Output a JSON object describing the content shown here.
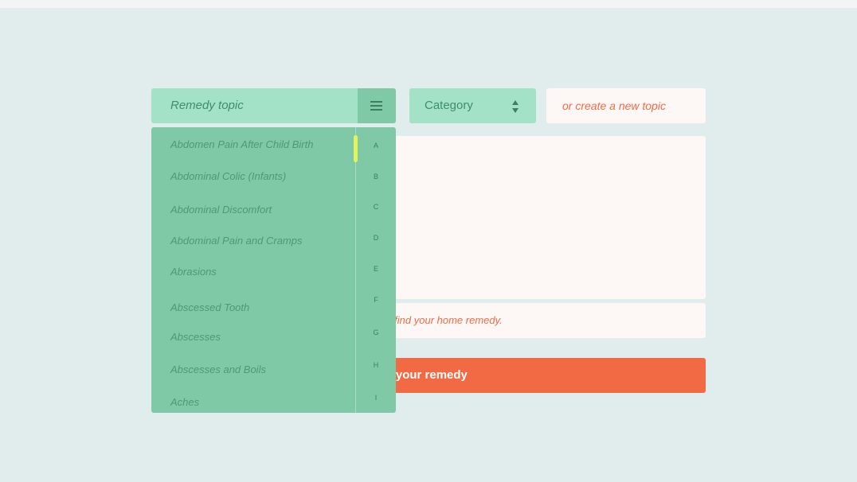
{
  "form": {
    "topic_placeholder": "Remedy topic",
    "category_label": "Category",
    "new_topic_placeholder": "or create a new topic",
    "tags_hint_visible": "sers find your home remedy.",
    "share_button_visible": "hare your remedy"
  },
  "dropdown": {
    "items": [
      "Abdomen Pain After Child Birth",
      "Abdominal Colic (Infants)",
      "Abdominal Discomfort",
      "Abdominal Pain and Cramps",
      "Abrasions",
      "Abscessed Tooth",
      "Abscesses",
      "Abscesses and Boils",
      "Aches"
    ],
    "alphabet": [
      "A",
      "B",
      "C",
      "D",
      "E",
      "F",
      "G",
      "H",
      "I"
    ],
    "scroll_position": 0
  },
  "icons": {
    "menu": "hamburger-icon",
    "category_toggle": "up-down-arrows-icon"
  },
  "colors": {
    "background": "#e0edec",
    "mint": "#a3e2c6",
    "mint_dark": "#7fc9a6",
    "accent_orange": "#f26a44",
    "scroll_thumb": "#e4f35a",
    "field_bg": "#fdf8f6"
  }
}
